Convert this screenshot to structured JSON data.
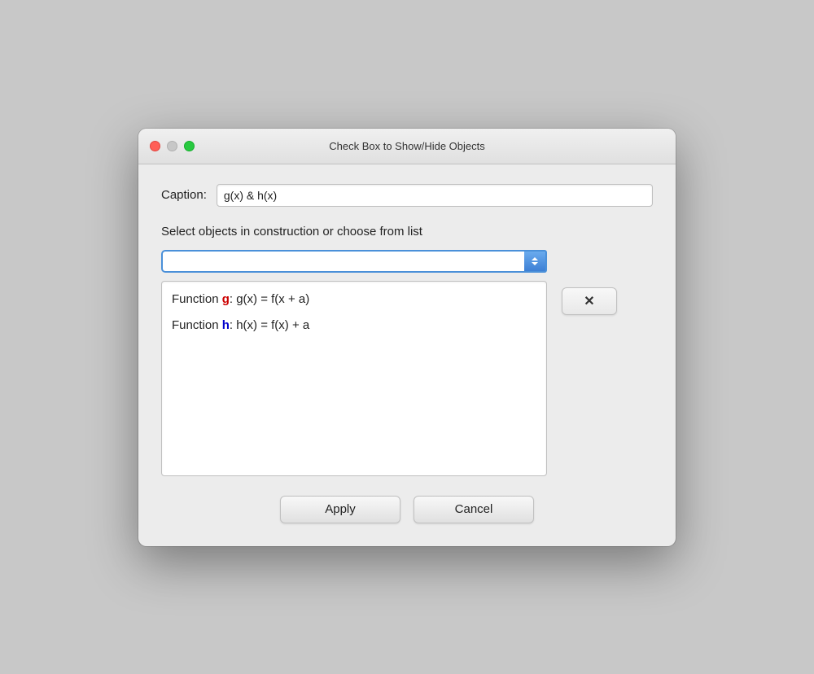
{
  "window": {
    "title": "Check Box to Show/Hide Objects",
    "traffic_lights": {
      "close_label": "close",
      "minimize_label": "minimize",
      "maximize_label": "maximize"
    }
  },
  "caption": {
    "label": "Caption:",
    "value": "g(x) & h(x)"
  },
  "instruction": {
    "text": "Select objects in construction or choose from list"
  },
  "combo": {
    "placeholder": ""
  },
  "list": {
    "items": [
      {
        "prefix": "Function ",
        "name": "g",
        "name_color": "red",
        "suffix": ": g(x) = f(x + a)"
      },
      {
        "prefix": "Function ",
        "name": "h",
        "name_color": "blue",
        "suffix": ": h(x) = f(x) + a"
      }
    ]
  },
  "buttons": {
    "remove_label": "✕",
    "apply_label": "Apply",
    "cancel_label": "Cancel"
  }
}
